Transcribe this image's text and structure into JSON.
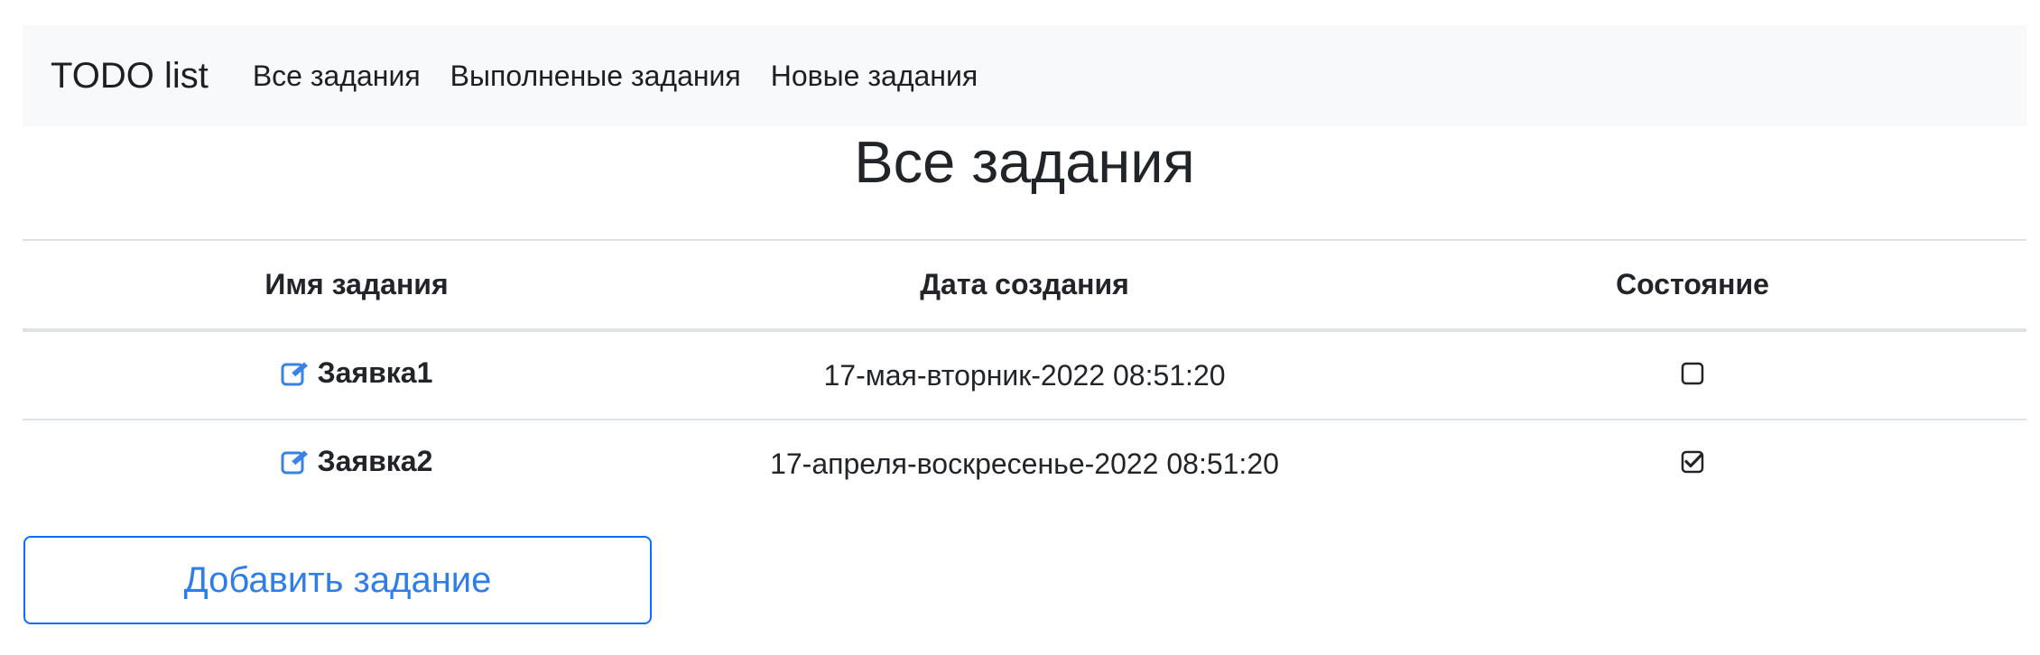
{
  "navbar": {
    "brand": "TODO list",
    "links": [
      "Все задания",
      "Выполненые задания",
      "Новые задания"
    ]
  },
  "page_title": "Все задания",
  "table": {
    "headers": [
      "Имя задания",
      "Дата создания",
      "Состояние"
    ],
    "rows": [
      {
        "name": "Заявка1",
        "created": "17-мая-вторник-2022 08:51:20",
        "done": false
      },
      {
        "name": "Заявка2",
        "created": "17-апреля-воскресенье-2022 08:51:20",
        "done": true
      }
    ],
    "edit_icon": "edit-pencil-square-icon"
  },
  "add_button_label": "Добавить задание",
  "colors": {
    "accent": "#0d6efd",
    "accent_text": "#2f7de9",
    "navbar_bg": "#f8f9fa",
    "border": "#dee2e6",
    "text": "#212529"
  }
}
